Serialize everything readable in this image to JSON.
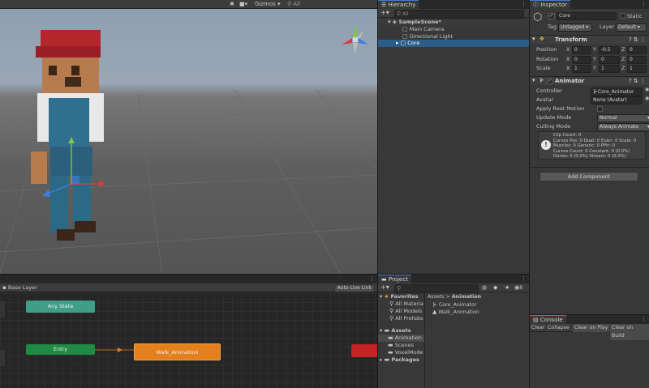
{
  "scene": {
    "gizmos_label": "Gizmos",
    "search_label": "All"
  },
  "hierarchy": {
    "tab": "Hierarchy",
    "search_label": "All",
    "items": [
      {
        "label": "SampleScene*",
        "level": 0
      },
      {
        "label": "Main Camera",
        "level": 1
      },
      {
        "label": "Directional Light",
        "level": 1
      },
      {
        "label": "Core",
        "level": 1
      }
    ]
  },
  "inspector": {
    "tab": "Inspector",
    "object_name": "Core",
    "static_label": "Static",
    "tag_label": "Tag",
    "tag_value": "Untagged",
    "layer_label": "Layer",
    "layer_value": "Default",
    "transform": {
      "title": "Transform",
      "position_label": "Position",
      "rotation_label": "Rotation",
      "scale_label": "Scale",
      "axes": [
        "X",
        "Y",
        "Z"
      ],
      "position": [
        "0",
        "-0.5",
        "0"
      ],
      "rotation": [
        "0",
        "0",
        "0"
      ],
      "scale": [
        "1",
        "1",
        "1"
      ]
    },
    "animator": {
      "title": "Animator",
      "controller_label": "Controller",
      "controller_value": "Core_Animator",
      "avatar_label": "Avatar",
      "avatar_value": "None (Avatar)",
      "root_motion_label": "Apply Root Motion",
      "update_label": "Update Mode",
      "update_value": "Normal",
      "culling_label": "Culling Mode",
      "culling_value": "Always Animate",
      "info": [
        "Clip Count: 0",
        "Curves Pos: 0 Quat: 0 Euler: 0 Scale: 0",
        "Muscles: 0 Generic: 0 PPtr: 0",
        "Curves Count: 0 Constant: 0 (0.0%)",
        "Dense: 0 (0.0%) Stream: 0 (0.0%)"
      ]
    },
    "add_component": "Add Component"
  },
  "animator_view": {
    "base_layer": "Base Layer",
    "auto_live_link": "Auto Live Link",
    "states": {
      "any": "Any State",
      "entry": "Entry",
      "walk": "Walk_Animation"
    }
  },
  "project": {
    "tab": "Project",
    "count": "8",
    "favorites": {
      "title": "Favorites",
      "items": [
        "All Materia",
        "All Models",
        "All Prefabs"
      ]
    },
    "assets": {
      "title": "Assets",
      "items": [
        "Animation",
        "Scenes",
        "VoxelMode"
      ]
    },
    "packages": "Packages",
    "breadcrumb": {
      "root": "Assets",
      "sep": ">",
      "current": "Animation"
    },
    "files": [
      "Core_Animator",
      "Walk_Animation"
    ]
  },
  "console": {
    "tab": "Console",
    "buttons": [
      "Clear",
      "Collapse",
      "Clear on Play",
      "Clear on Build"
    ]
  },
  "colors": {
    "accent": "#3d7fd6",
    "selection": "#2c5d87",
    "entry": "#1e8a44",
    "walk": "#e3801c",
    "any": "#3e9f86"
  }
}
